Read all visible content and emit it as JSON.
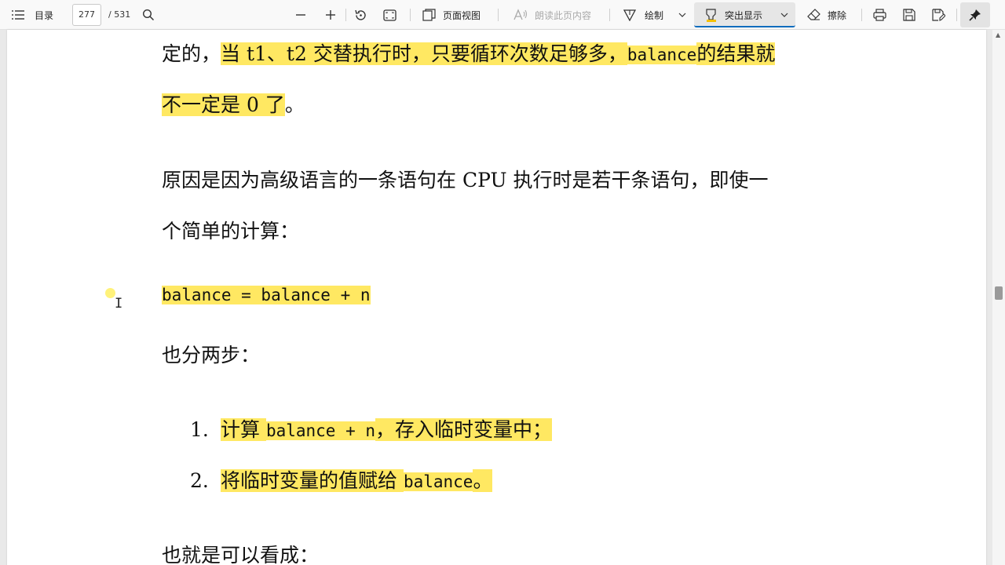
{
  "toolbar": {
    "contents_label": "目录",
    "page_current": "277",
    "page_total": "/ 531",
    "page_view_label": "页面视图",
    "read_aloud_label": "朗读此页内容",
    "draw_label": "绘制",
    "highlight_label": "突出显示",
    "erase_label": "擦除",
    "icons": [
      "menu-icon",
      "search-icon",
      "zoom-out-icon",
      "zoom-in-icon",
      "rotate-icon",
      "fit-page-icon",
      "page-view-icon",
      "read-aloud-icon",
      "draw-icon",
      "highlight-icon",
      "eraser-icon",
      "print-icon",
      "save-icon",
      "save-as-icon",
      "pin-icon"
    ],
    "accent_color": "#0f6cbd"
  },
  "document": {
    "highlight_color": "#ffe862",
    "line1": {
      "pre": "定的，",
      "hl_a": "当 t1、t2 交替执行时，只要循环次数足够多，",
      "code": "balance",
      "hl_b": "的结果就"
    },
    "line2": {
      "hl": "不一定是 0 了",
      "post": "。"
    },
    "line3": "原因是因为高级语言的一条语句在 CPU 执行时是若干条语句，即使一",
    "line4": "个简单的计算：",
    "code_line": "balance = balance + n",
    "line5": "也分两步：",
    "steps": [
      {
        "num": "1.",
        "pre": "计算 ",
        "code": "balance + n",
        "post": "，存入临时变量中；"
      },
      {
        "num": "2.",
        "pre": "将临时变量的值赋给 ",
        "code": "balance",
        "post": "。"
      }
    ],
    "line6": "也就是可以看成："
  }
}
